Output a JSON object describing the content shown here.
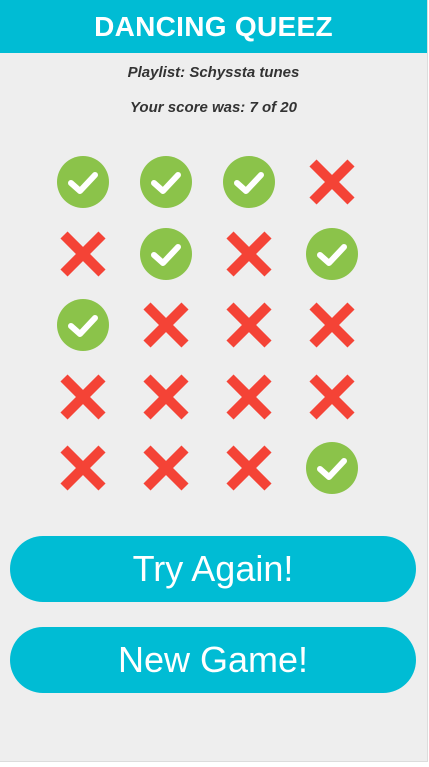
{
  "header": {
    "title": "DANCING QUEEZ"
  },
  "summary": {
    "playlist_text": "Playlist: Schyssta tunes",
    "score_text": "Your score was: 7 of 20"
  },
  "results": [
    "correct",
    "correct",
    "correct",
    "wrong",
    "wrong",
    "correct",
    "wrong",
    "correct",
    "correct",
    "wrong",
    "wrong",
    "wrong",
    "wrong",
    "wrong",
    "wrong",
    "wrong",
    "wrong",
    "wrong",
    "wrong",
    "correct"
  ],
  "icons": {
    "correct": "check-circle-icon",
    "wrong": "cross-icon"
  },
  "colors": {
    "accent": "#00bcd4",
    "correct": "#8bc34a",
    "wrong": "#f44336",
    "background": "#eeeeee"
  },
  "buttons": {
    "try_again_label": "Try Again!",
    "new_game_label": "New Game!"
  }
}
